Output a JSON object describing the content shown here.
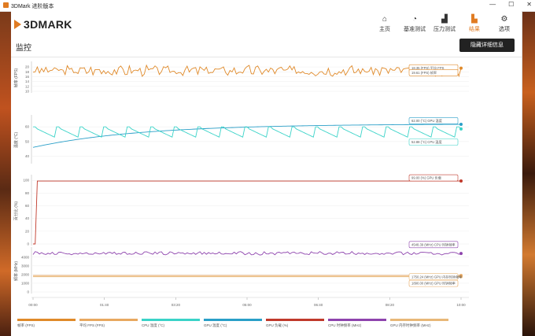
{
  "window": {
    "title": "3DMark 进阶版本",
    "minimize": "—",
    "maximize": "☐",
    "close": "✕"
  },
  "brand": {
    "name": "3DMARK"
  },
  "nav": [
    {
      "label": "主页",
      "icon": "home-icon",
      "glyph": "⌂"
    },
    {
      "label": "基准测试",
      "icon": "gauge-icon",
      "glyph": "◔"
    },
    {
      "label": "压力测试",
      "icon": "stress-chart-icon",
      "glyph": "▟"
    },
    {
      "label": "结果",
      "icon": "results-icon",
      "glyph": "▙"
    },
    {
      "label": "选项",
      "icon": "gear-icon",
      "glyph": "⚙"
    }
  ],
  "active_nav": "结果",
  "page": {
    "title": "监控",
    "hide_details_button": "隐藏详细信息"
  },
  "colors": {
    "accent": "#e07b22",
    "fps": "#e08a2a",
    "fps_avg": "#e8a860",
    "cpu_temp": "#3ad3c8",
    "gpu_temp": "#2a9fc8",
    "gpu_load": "#c0392b",
    "cpu_clock": "#8e44ad",
    "gpu_mem_clock": "#e8b878"
  },
  "chart_data": {
    "type": "line",
    "x_ticks": [
      "00:00",
      "01:40",
      "03:20",
      "05:00",
      "06:40",
      "08:20",
      "10:00"
    ],
    "panels": [
      {
        "ylabel": "帧率 (FPS)",
        "yticks": [
          10,
          12,
          14,
          16,
          18,
          20
        ],
        "ylim": [
          10,
          21
        ],
        "series": [
          {
            "name": "帧率 (FPS)",
            "color": "#e08a2a",
            "base": 18.5,
            "amp": 1.9,
            "kind": "noisy"
          }
        ],
        "annotations": [
          {
            "text": "18.35 (FPS) 平均 FPS",
            "value": 18.35
          },
          {
            "text": "19.61 (FPS) 帧率",
            "value": 19.61
          }
        ]
      },
      {
        "ylabel": "温度 (°C)",
        "yticks": [
          40,
          50,
          60
        ],
        "ylim": [
          36,
          66
        ],
        "series": [
          {
            "name": "GPU 温度 (°C)",
            "color": "#2a9fc8",
            "kind": "rise",
            "start": 46,
            "end": 62
          },
          {
            "name": "CPU 温度 (°C)",
            "color": "#3ad3c8",
            "kind": "saw",
            "base": 53,
            "amp": 7
          }
        ],
        "annotations": [
          {
            "text": "62.00 (°C) GPU 温度",
            "value": 62.0
          },
          {
            "text": "52.88 (°C) CPU 温度",
            "value": 52.88
          }
        ]
      },
      {
        "ylabel": "百分比 (%)",
        "yticks": [
          0,
          20,
          40,
          60,
          80,
          100
        ],
        "ylim": [
          0,
          104
        ],
        "series": [
          {
            "name": "GPU 负载 (%)",
            "color": "#c0392b",
            "kind": "step",
            "value": 99
          }
        ],
        "annotations": [
          {
            "text": "99.00 (%) GPU 负载",
            "value": 99.0
          }
        ]
      },
      {
        "ylabel": "频率 (MHz)",
        "yticks": [
          0,
          1000,
          2000,
          3000,
          4000
        ],
        "ylim": [
          0,
          4800
        ],
        "series": [
          {
            "name": "CPU 时钟频率 (MHz)",
            "color": "#8e44ad",
            "kind": "noisy",
            "base": 4450,
            "amp": 160
          },
          {
            "name": "GPU 内存时钟频率 (MHz)",
            "color": "#e8b878",
            "kind": "flat",
            "value": 1750
          },
          {
            "name": "GPU 时钟频率 (MHz)",
            "color": "#e8a860",
            "kind": "flat",
            "value": 1890
          }
        ],
        "annotations": [
          {
            "text": "4548.39 (MHz) CPU 时钟频率",
            "value": 4548.39
          },
          {
            "text": "1750.24 (MHz) GPU 内存时钟频率",
            "value": 1750.24
          },
          {
            "text": "1890.00 (MHz) GPU 时钟频率",
            "value": 1890.0
          }
        ]
      }
    ],
    "legend": [
      {
        "label": "帧率 (FPS)",
        "color": "#e08a2a"
      },
      {
        "label": "平均 FPS (FPS)",
        "color": "#e8a860"
      },
      {
        "label": "CPU 温度 (°C)",
        "color": "#3ad3c8"
      },
      {
        "label": "GPU 温度 (°C)",
        "color": "#2a9fc8"
      },
      {
        "label": "GPU 负载 (%)",
        "color": "#c0392b"
      },
      {
        "label": "CPU 时钟频率 (MHz)",
        "color": "#8e44ad"
      },
      {
        "label": "GPU 内存时钟频率 (MHz)",
        "color": "#e8b878"
      }
    ]
  }
}
